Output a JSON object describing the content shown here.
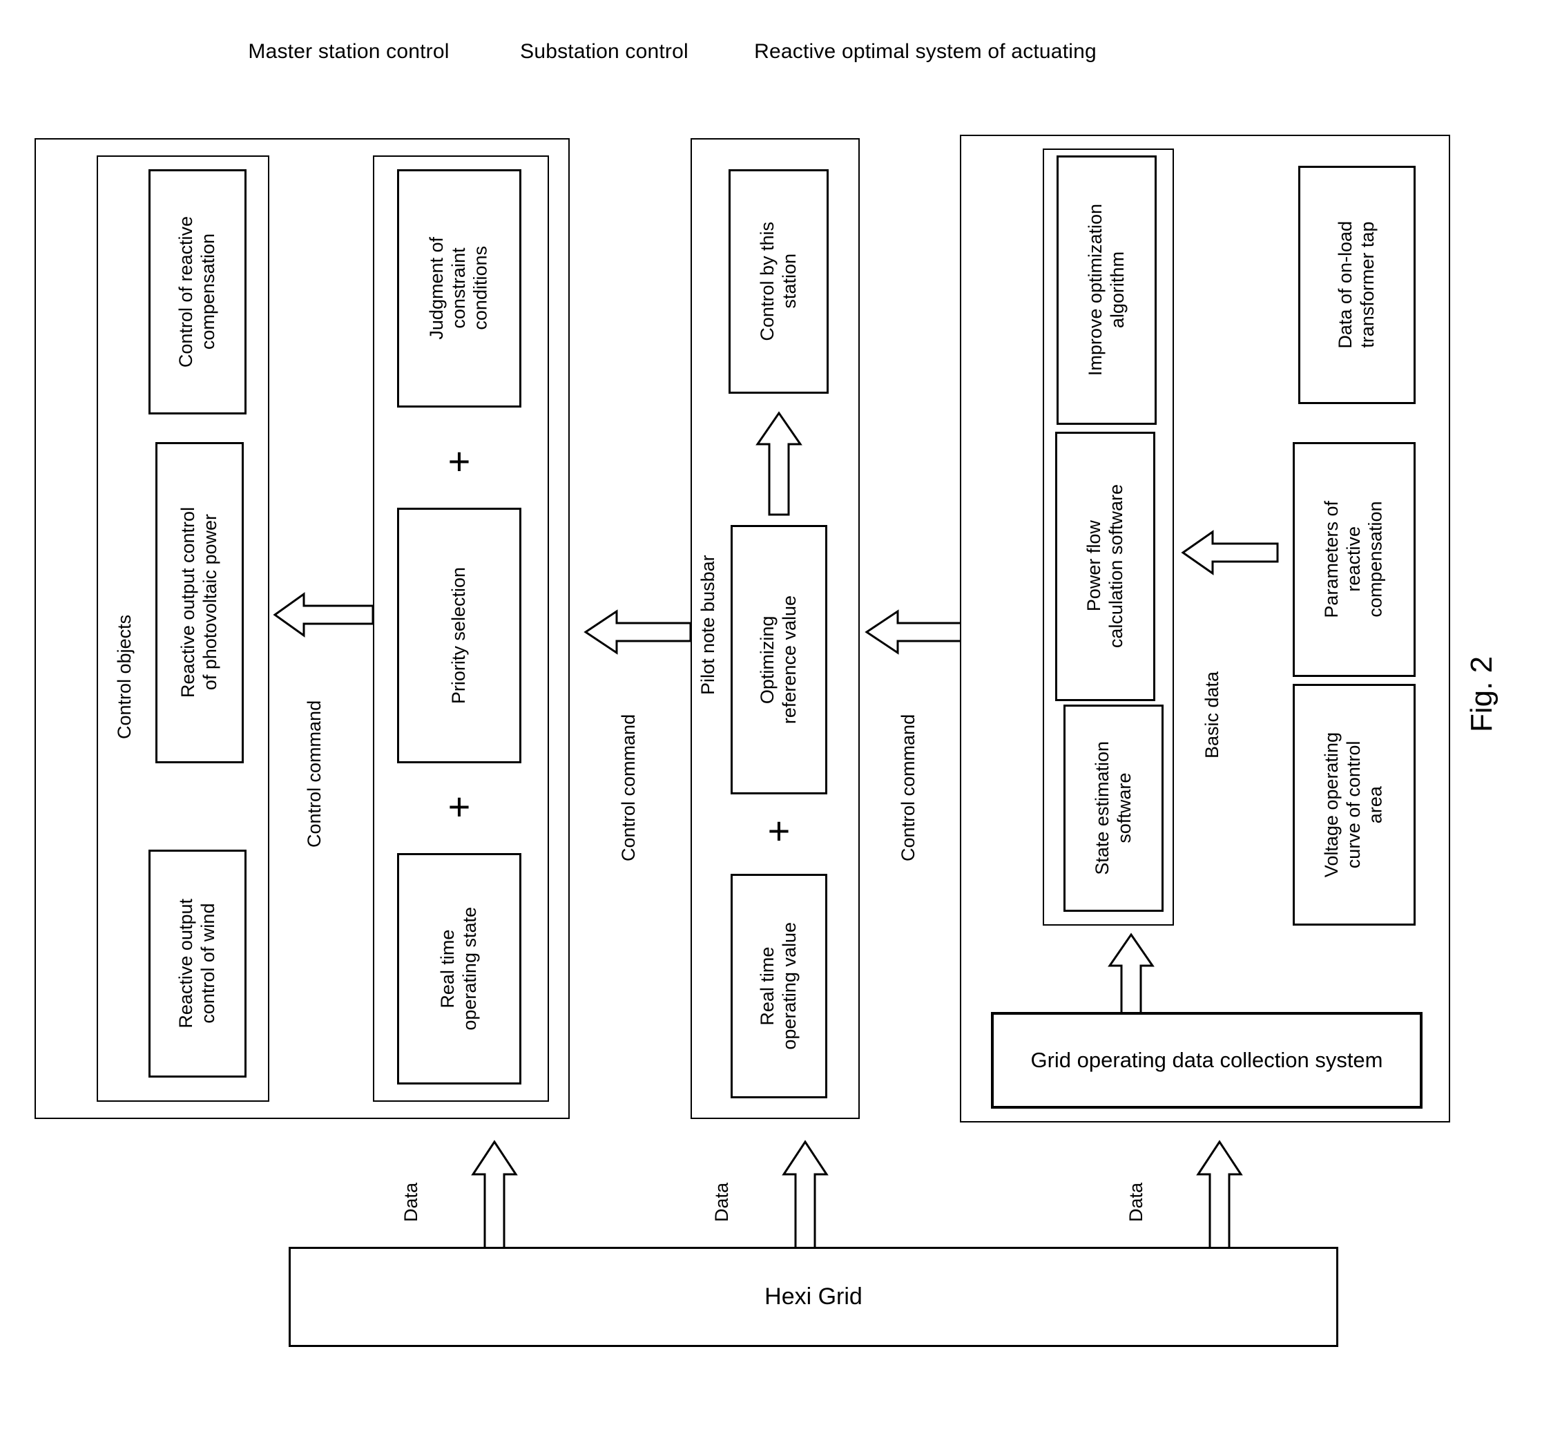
{
  "figure": {
    "caption": "Fig. 2"
  },
  "columns": [
    {
      "id": "master",
      "title": "Master station control"
    },
    {
      "id": "substation",
      "title": "Substation control"
    },
    {
      "id": "reactive",
      "title": "Reactive optimal system of actuating"
    }
  ],
  "master_station": {
    "control_objects": {
      "group_label": "Control objects",
      "boxes": [
        {
          "label": "Control of reactive\ncompensation"
        },
        {
          "label": "Reactive output control\nof photovoltaic power"
        },
        {
          "label": "Reactive output\ncontrol of wind"
        }
      ]
    },
    "decision": {
      "boxes": [
        {
          "label": "Judgment of\nconstraint\nconditions"
        },
        {
          "label": "Priority selection"
        },
        {
          "label": "Real time\noperating state"
        }
      ],
      "operators": [
        "+",
        "+"
      ]
    },
    "command_label": "Control command",
    "data_label": "Data"
  },
  "substation": {
    "pilot_label": "Pilot note busbar",
    "boxes": [
      {
        "label": "Control by this\nstation"
      },
      {
        "label": "Optimizing\nreference value"
      },
      {
        "label": "Real time\noperating value"
      }
    ],
    "operators": [
      "+"
    ],
    "command_label": "Control command",
    "data_label": "Data"
  },
  "reactive_system": {
    "software_boxes": [
      {
        "label": "Improve optimization\nalgorithm"
      },
      {
        "label": "Power flow\ncalculation software"
      },
      {
        "label": "State estimation\nsoftware"
      }
    ],
    "basic_data_label": "Basic data",
    "basic_data_boxes": [
      {
        "label": "Data of on-load\ntransformer tap"
      },
      {
        "label": "Parameters of\nreactive\ncompensation"
      },
      {
        "label": "Voltage operating\ncurve of control\narea"
      }
    ],
    "collection_system": "Grid operating data collection system",
    "data_label": "Data"
  },
  "bottom": {
    "grid_label": "Hexi Grid"
  },
  "colors": {
    "stroke": "#000000",
    "background": "#ffffff"
  }
}
